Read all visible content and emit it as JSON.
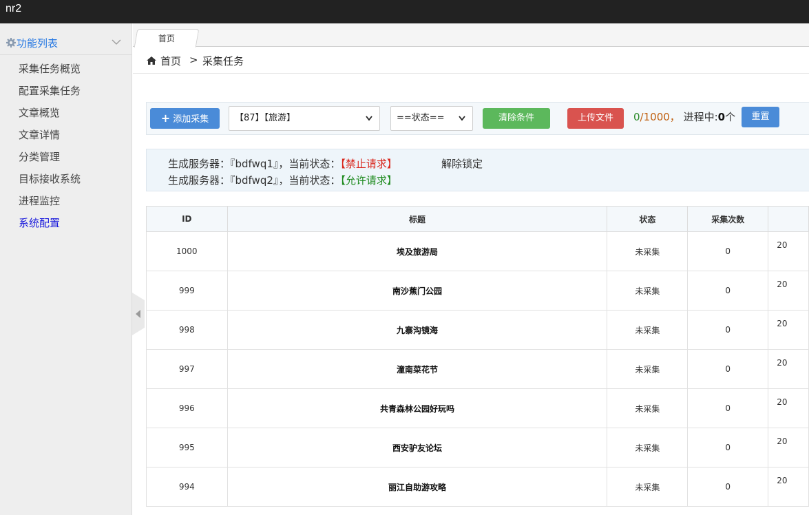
{
  "app": {
    "title": "nr2"
  },
  "sidebar": {
    "header": "功能列表",
    "items": [
      {
        "label": "采集任务概览"
      },
      {
        "label": "配置采集任务"
      },
      {
        "label": "文章概览"
      },
      {
        "label": "文章详情"
      },
      {
        "label": "分类管理"
      },
      {
        "label": "目标接收系统"
      },
      {
        "label": "进程监控"
      },
      {
        "label": "系统配置"
      }
    ]
  },
  "tabs": [
    {
      "label": "首页"
    }
  ],
  "breadcrumb": {
    "home": "首页",
    "separator": ">",
    "current": "采集任务"
  },
  "toolbar": {
    "add_label": "添加采集",
    "category_select": "【87】【旅游】",
    "status_select": "==状态==",
    "clear_label": "清除条件",
    "upload_label": "上传文件",
    "progress_done": "0",
    "progress_total": "/1000",
    "progress_sep": "，",
    "running_label": "进程中:",
    "running_count": "0",
    "running_unit": "个",
    "reset_label": "重置"
  },
  "servers": [
    {
      "prefix": "生成服务器：『bdfwq1』，当前状态：",
      "status": "【禁止请求】",
      "status_color": "#d9261c"
    },
    {
      "prefix": "生成服务器：『bdfwq2』，当前状态：",
      "status": "【允许请求】",
      "status_color": "#1f8b1f"
    }
  ],
  "unlock_label": "解除锁定",
  "table": {
    "headers": [
      "ID",
      "标题",
      "状态",
      "采集次数",
      ""
    ],
    "rows": [
      {
        "id": "1000",
        "title": "埃及旅游局",
        "status": "未采集",
        "count": "0",
        "date": "20"
      },
      {
        "id": "999",
        "title": "南沙蕉门公园",
        "status": "未采集",
        "count": "0",
        "date": "20"
      },
      {
        "id": "998",
        "title": "九寨沟镜海",
        "status": "未采集",
        "count": "0",
        "date": "20"
      },
      {
        "id": "997",
        "title": "潼南菜花节",
        "status": "未采集",
        "count": "0",
        "date": "20"
      },
      {
        "id": "996",
        "title": "共青森林公园好玩吗",
        "status": "未采集",
        "count": "0",
        "date": "20"
      },
      {
        "id": "995",
        "title": "西安驴友论坛",
        "status": "未采集",
        "count": "0",
        "date": "20"
      },
      {
        "id": "994",
        "title": "丽江自助游攻略",
        "status": "未采集",
        "count": "0",
        "date": "20"
      }
    ]
  },
  "colors": {
    "topbar": "#222222",
    "primary": "#4a8bd8",
    "success": "#5cb85c",
    "danger": "#d9534f",
    "active_nav": "#1a1adc"
  }
}
